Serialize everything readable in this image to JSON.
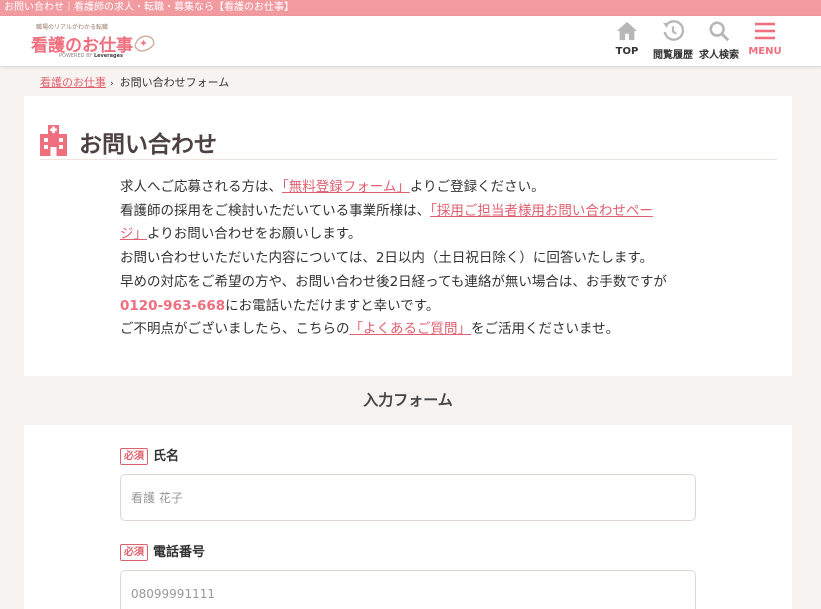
{
  "topbar": {
    "text": "お問い合わせ｜看護師の求人・転職・募集なら【看護のお仕事】"
  },
  "header": {
    "logo_tagline": "職場のリアルがわかる転職",
    "logo_main": "看護のお仕事",
    "logo_powered": "POWERED BY",
    "logo_company": "Leverages",
    "nav": [
      {
        "label": "TOP",
        "icon": "home-icon"
      },
      {
        "label": "閲覧履歴",
        "icon": "history-icon"
      },
      {
        "label": "求人検索",
        "icon": "search-icon"
      },
      {
        "label": "MENU",
        "icon": "hamburger-icon"
      }
    ]
  },
  "breadcrumb": {
    "home": "看護のお仕事",
    "separator": "›",
    "current": "お問い合わせフォーム"
  },
  "page": {
    "title": "お問い合わせ"
  },
  "intro": {
    "l1_pre": "求人へご応募される方は、",
    "l1_link": "「無料登録フォーム」",
    "l1_post": "よりご登録ください。",
    "l2_pre": "看護師の採用をご検討いただいている事業所様は、",
    "l2_link_a": "「採用ご担当者様用お問い合わせペー",
    "l3_link_b": "ジ」",
    "l3_post": "よりお問い合わせをお願いします。",
    "l4": "お問い合わせいただいた内容については、2日以内（土日祝日除く）に回答いたします。",
    "l5": "早めの対応をご希望の方や、お問い合わせ後2日経っても連絡が無い場合は、お手数ですが",
    "l6_tel": "0120-963-668",
    "l6_post": "にお電話いただけますと幸いです。",
    "l7_pre": "ご不明点がございましたら、こちらの",
    "l7_link": "「よくあるご質問」",
    "l7_post": "をご活用くださいませ。"
  },
  "form": {
    "heading": "入力フォーム",
    "required_badge": "必須",
    "name_label": "氏名",
    "name_placeholder": "看護 花子",
    "phone_label": "電話番号",
    "phone_placeholder": "08099991111"
  },
  "colors": {
    "brand_pink": "#ef6f7f",
    "link": "#e0606f",
    "topbar": "#f19aa0"
  }
}
